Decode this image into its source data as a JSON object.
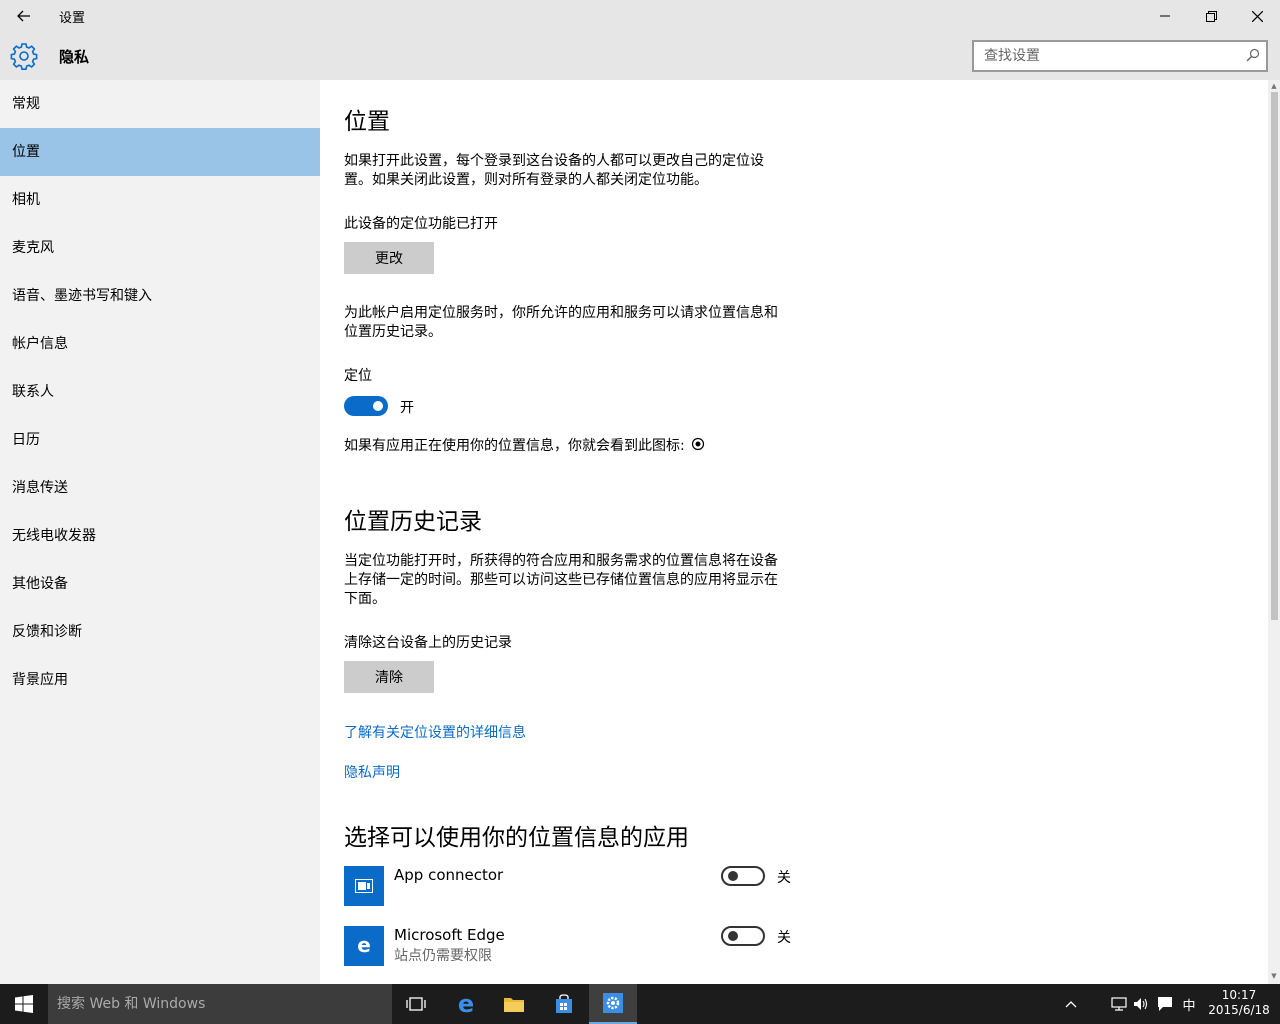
{
  "titlebar": {
    "title": "设置"
  },
  "header": {
    "section": "隐私",
    "search_placeholder": "查找设置"
  },
  "sidebar": {
    "items": [
      {
        "label": "常规"
      },
      {
        "label": "位置",
        "active": true
      },
      {
        "label": "相机"
      },
      {
        "label": "麦克风"
      },
      {
        "label": "语音、墨迹书写和键入"
      },
      {
        "label": "帐户信息"
      },
      {
        "label": "联系人"
      },
      {
        "label": "日历"
      },
      {
        "label": "消息传送"
      },
      {
        "label": "无线电收发器"
      },
      {
        "label": "其他设备"
      },
      {
        "label": "反馈和诊断"
      },
      {
        "label": "背景应用"
      }
    ]
  },
  "main": {
    "location": {
      "heading": "位置",
      "desc": "如果打开此设置，每个登录到这台设备的人都可以更改自己的定位设置。如果关闭此设置，则对所有登录的人都关闭定位功能。",
      "device_status": "此设备的定位功能已打开",
      "change_button": "更改",
      "account_desc": "为此帐户启用定位服务时，你所允许的应用和服务可以请求位置信息和位置历史记录。",
      "toggle_label": "定位",
      "toggle_on": true,
      "toggle_state": "开",
      "icon_note": "如果有应用正在使用你的位置信息，你就会看到此图标:"
    },
    "history": {
      "heading": "位置历史记录",
      "desc": "当定位功能打开时，所获得的符合应用和服务需求的位置信息将在设备上存储一定的时间。那些可以访问这些已存储位置信息的应用将显示在下面。",
      "clear_label": "清除这台设备上的历史记录",
      "clear_button": "清除"
    },
    "links": {
      "learn_more": "了解有关定位设置的详细信息",
      "privacy": "隐私声明"
    },
    "apps": {
      "heading": "选择可以使用你的位置信息的应用",
      "list": [
        {
          "name": "App connector",
          "sub": "",
          "state": "关",
          "on": false
        },
        {
          "name": "Microsoft Edge",
          "sub": "站点仍需要权限",
          "state": "关",
          "on": false
        }
      ]
    }
  },
  "taskbar": {
    "search_text": "搜索 Web 和 Windows",
    "ime": "中",
    "time": "10:17",
    "date": "2015/6/18"
  },
  "colors": {
    "accent": "#0a6bc9",
    "nav_active": "#99c4e8",
    "chrome": "#e6e6e6",
    "sidebar": "#f2f2f2",
    "taskbar": "#1c1c1c"
  }
}
